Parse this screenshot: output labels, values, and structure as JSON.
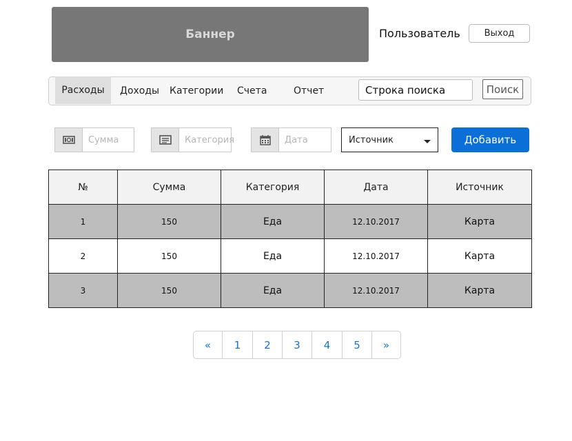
{
  "header": {
    "banner": "Баннер",
    "user_label": "Пользователь",
    "logout_label": "Выход"
  },
  "nav": {
    "items": [
      {
        "label": "Расходы",
        "active": true
      },
      {
        "label": "Доходы",
        "active": false
      },
      {
        "label": "Категории",
        "active": false
      },
      {
        "label": "Счета",
        "active": false
      },
      {
        "label": "Отчет",
        "active": false
      }
    ],
    "search_placeholder": "Строка поиска",
    "search_button": "Поиск"
  },
  "form": {
    "amount_placeholder": "Сумма",
    "category_placeholder": "Категория",
    "date_placeholder": "Дата",
    "source_selected": "Источник",
    "add_button": "Добавить",
    "icons": [
      "money-icon",
      "list-icon",
      "calendar-icon"
    ]
  },
  "table": {
    "columns": [
      "№",
      "Сумма",
      "Категория",
      "Дата",
      "Источник"
    ],
    "rows": [
      [
        "1",
        "150",
        "Еда",
        "12.10.2017",
        "Карта"
      ],
      [
        "2",
        "150",
        "Еда",
        "12.10.2017",
        "Карта"
      ],
      [
        "3",
        "150",
        "Еда",
        "12.10.2017",
        "Карта"
      ]
    ]
  },
  "pagination": {
    "prev": "«",
    "pages": [
      "1",
      "2",
      "3",
      "4",
      "5"
    ],
    "next": "»"
  },
  "colors": {
    "banner": "#777777",
    "accent": "#0a6fd6",
    "link": "#1a73c9",
    "row_shade": "#bdbdbd"
  }
}
